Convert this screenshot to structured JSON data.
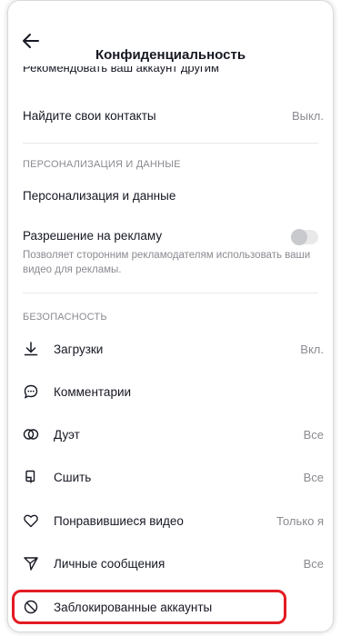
{
  "header": {
    "title": "Конфиденциальность"
  },
  "clipped_row": {
    "text": "Рекомендовать ваш аккаунт другим"
  },
  "contacts": {
    "label": "Найдите свои контакты",
    "value": "Выкл."
  },
  "personalization_section": {
    "header": "ПЕРСОНАЛИЗАЦИЯ И ДАННЫЕ",
    "item_label": "Персонализация и данные",
    "ads": {
      "label": "Разрешение на рекламу",
      "description": "Позволяет сторонним рекламодателям использовать ваши видео для рекламы.",
      "toggle_on": false
    }
  },
  "safety_section": {
    "header": "БЕЗОПАСНОСТЬ",
    "items": [
      {
        "label": "Загрузки",
        "value": "Вкл.",
        "icon": "download-icon"
      },
      {
        "label": "Комментарии",
        "value": "",
        "icon": "comment-icon"
      },
      {
        "label": "Дуэт",
        "value": "Все",
        "icon": "duet-icon"
      },
      {
        "label": "Сшить",
        "value": "Все",
        "icon": "stitch-icon"
      },
      {
        "label": "Понравившиеся видео",
        "value": "Только я",
        "icon": "heart-icon"
      },
      {
        "label": "Личные сообщения",
        "value": "Все",
        "icon": "send-icon"
      },
      {
        "label": "Заблокированные аккаунты",
        "value": "",
        "icon": "block-icon"
      }
    ]
  },
  "colors": {
    "highlight": "#e31b23",
    "secondary_text": "#8a8b91",
    "primary_text": "#161823"
  }
}
